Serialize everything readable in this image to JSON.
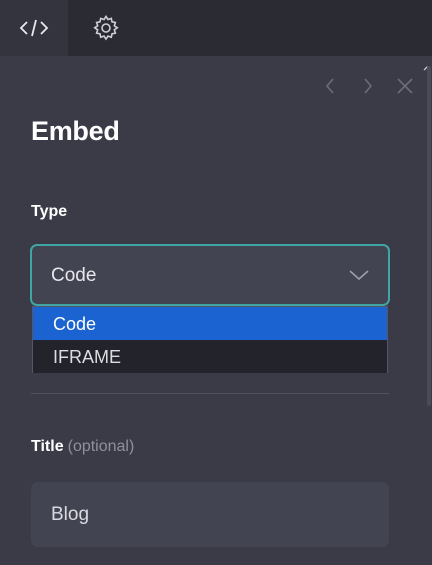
{
  "tabs": [
    {
      "icon": "code-icon",
      "active": true
    },
    {
      "icon": "gear-icon",
      "active": false
    }
  ],
  "nav": {
    "prev_icon": "chevron-left-icon",
    "next_icon": "chevron-right-icon",
    "close_icon": "close-icon"
  },
  "panel": {
    "title": "Embed",
    "type_label": "Type",
    "type_select": {
      "value": "Code",
      "options": [
        "Code",
        "IFRAME"
      ],
      "highlighted": "Code"
    },
    "title_label": "Title",
    "title_optional": "(optional)",
    "title_value": "Blog"
  },
  "colors": {
    "background": "#3a3b47",
    "tabbar": "#2a2b33",
    "focus_border": "#3fa6a3",
    "highlight": "#1b63d0"
  }
}
